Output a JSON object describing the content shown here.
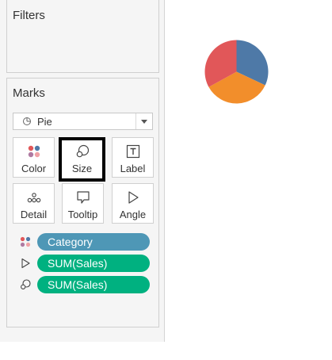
{
  "filters": {
    "title": "Filters"
  },
  "marks": {
    "title": "Marks",
    "mark_type": {
      "label": "Pie",
      "icon": "pie-icon"
    },
    "cards": [
      {
        "label": "Color",
        "icon": "color-dots-icon",
        "selected": false
      },
      {
        "label": "Size",
        "icon": "size-circles-icon",
        "selected": true
      },
      {
        "label": "Label",
        "icon": "text-label-icon",
        "selected": false
      },
      {
        "label": "Detail",
        "icon": "detail-dots-icon",
        "selected": false
      },
      {
        "label": "Tooltip",
        "icon": "tooltip-bubble-icon",
        "selected": false
      },
      {
        "label": "Angle",
        "icon": "angle-icon",
        "selected": false
      }
    ],
    "fields": [
      {
        "label": "Category",
        "encoding": "color",
        "icon": "color-dots-icon",
        "pill_color": "#4e97b6"
      },
      {
        "label": "SUM(Sales)",
        "encoding": "angle",
        "icon": "angle-icon",
        "pill_color": "#00b180"
      },
      {
        "label": "SUM(Sales)",
        "encoding": "size",
        "icon": "size-circles-icon",
        "pill_color": "#00b180"
      }
    ]
  },
  "chart_data": {
    "type": "pie",
    "slices": [
      {
        "share": 0.32,
        "color": "#4e79a7"
      },
      {
        "share": 0.35,
        "color": "#f28e2b"
      },
      {
        "share": 0.33,
        "color": "#e15759"
      }
    ]
  }
}
